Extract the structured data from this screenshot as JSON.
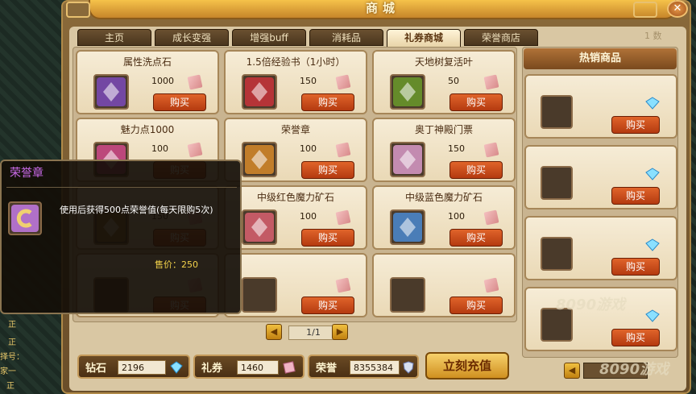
{
  "window": {
    "title": "商城",
    "close_symbol": "✕",
    "page_indicator": "1 数"
  },
  "tabs": [
    {
      "label": "主页",
      "active": false
    },
    {
      "label": "成长变强",
      "active": false
    },
    {
      "label": "增强buff",
      "active": false
    },
    {
      "label": "消耗品",
      "active": false
    },
    {
      "label": "礼券商城",
      "active": true
    },
    {
      "label": "荣誉商店",
      "active": false
    }
  ],
  "items": [
    {
      "name": "属性洗点石",
      "price": "1000",
      "buy": "购买",
      "icon": "purple-crystal-icon",
      "color": "#7a4ab8"
    },
    {
      "name": "1.5倍经验书（1小时）",
      "price": "150",
      "buy": "购买",
      "icon": "red-book-icon",
      "color": "#c8343a"
    },
    {
      "name": "天地树复活叶",
      "price": "50",
      "buy": "购买",
      "icon": "green-leaf-icon",
      "color": "#6a9a2a"
    },
    {
      "name": "魅力点1000",
      "price": "100",
      "buy": "购买",
      "icon": "charm-icon",
      "color": "#d04a8a"
    },
    {
      "name": "荣誉章",
      "price": "100",
      "buy": "购买",
      "icon": "honor-badge-icon",
      "color": "#d68a2a"
    },
    {
      "name": "奥丁神殿门票",
      "price": "150",
      "buy": "购买",
      "icon": "ticket-icon",
      "color": "#d89ac8"
    },
    {
      "name": "",
      "price": "150",
      "buy": "购买",
      "icon": "book-icon",
      "color": "#9a6a2a"
    },
    {
      "name": "中级红色魔力矿石",
      "price": "100",
      "buy": "购买",
      "icon": "red-ore-icon",
      "color": "#d86070"
    },
    {
      "name": "中级蓝色魔力矿石",
      "price": "100",
      "buy": "购买",
      "icon": "blue-ore-icon",
      "color": "#4a8ad0"
    },
    {
      "name": "",
      "price": "",
      "buy": "购买",
      "icon": "empty-slot-icon",
      "color": ""
    },
    {
      "name": "",
      "price": "",
      "buy": "购买",
      "icon": "empty-slot-icon",
      "color": ""
    },
    {
      "name": "",
      "price": "",
      "buy": "购买",
      "icon": "empty-slot-icon",
      "color": ""
    }
  ],
  "pager": {
    "prev": "◀",
    "next": "▶",
    "page": "1/1"
  },
  "hot": {
    "title": "热销商品",
    "items": [
      {
        "buy": "购买",
        "icon": "diamond-icon"
      },
      {
        "buy": "购买",
        "icon": "diamond-icon"
      },
      {
        "buy": "购买",
        "icon": "diamond-icon"
      },
      {
        "buy": "购买",
        "icon": "diamond-icon"
      }
    ],
    "prev": "◀"
  },
  "wallet": {
    "diamond": {
      "label": "钻石",
      "value": "2196"
    },
    "coupon": {
      "label": "礼券",
      "value": "1460"
    },
    "honor": {
      "label": "荣誉",
      "value": "8355384"
    }
  },
  "charge_button": "立刻充值",
  "tooltip": {
    "title": "荣誉章",
    "desc": "使用后获得500点荣誉值(每天限购5次)",
    "price": "售价：250"
  },
  "side": {
    "a": "正",
    "b": "正",
    "c": "择号：",
    "d": "家一",
    "e": "正"
  },
  "watermark": "8090游戏"
}
